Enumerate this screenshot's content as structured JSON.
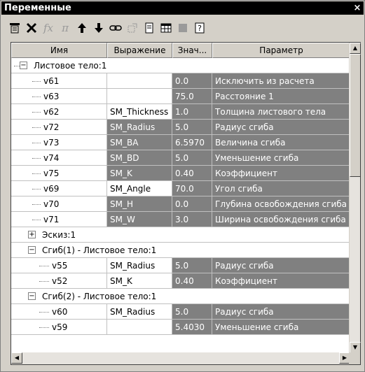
{
  "window": {
    "title": "Переменные",
    "close": "×"
  },
  "toolbar": [
    {
      "name": "variable-table-icon",
      "glyph": "▦",
      "enabled": true
    },
    {
      "name": "delete-icon",
      "glyph": "✕",
      "enabled": true
    },
    {
      "name": "function-icon",
      "glyph": "fx",
      "enabled": false
    },
    {
      "name": "pi-icon",
      "glyph": "π",
      "enabled": false
    },
    {
      "name": "move-up-icon",
      "glyph": "🡅",
      "enabled": true
    },
    {
      "name": "move-down-icon",
      "glyph": "🡇",
      "enabled": true
    },
    {
      "name": "link-icon",
      "glyph": "⚭",
      "enabled": true
    },
    {
      "name": "external-link-icon",
      "glyph": "⬚",
      "enabled": false
    },
    {
      "name": "insert-icon",
      "glyph": "🗎",
      "enabled": true
    },
    {
      "name": "table-icon",
      "glyph": "▤",
      "enabled": true
    },
    {
      "name": "book-icon",
      "glyph": "▮",
      "enabled": false
    },
    {
      "name": "help-icon",
      "glyph": "?",
      "enabled": true
    }
  ],
  "columns": {
    "name": "Имя",
    "expr": "Выражение",
    "val": "Знач...",
    "param": "Параметр"
  },
  "groups": {
    "g1": "Листовое тело:1",
    "g2": "Эскиз:1",
    "g3": "Сгиб(1) -  Листовое тело:1",
    "g4": "Сгиб(2) -  Листовое тело:1"
  },
  "rows": [
    {
      "name": "v61",
      "expr": "",
      "val": "0.0",
      "param": "Исключить из расчета"
    },
    {
      "name": "v63",
      "expr": "",
      "val": "75.0",
      "param": "Расстояние 1"
    },
    {
      "name": "v62",
      "expr": "SM_Thickness",
      "val": "1.0",
      "param": "Толщина листового тела"
    },
    {
      "name": "v72",
      "expr": "SM_Radius",
      "val": "5.0",
      "param": "Радиус сгиба"
    },
    {
      "name": "v73",
      "expr": "SM_BA",
      "val": "6.5970",
      "param": "Величина сгиба"
    },
    {
      "name": "v74",
      "expr": "SM_BD",
      "val": "5.0",
      "param": "Уменьшение сгиба"
    },
    {
      "name": "v75",
      "expr": "SM_K",
      "val": "0.40",
      "param": "Коэффициент"
    },
    {
      "name": "v69",
      "expr": "SM_Angle",
      "val": "70.0",
      "param": "Угол сгиба"
    },
    {
      "name": "v70",
      "expr": "SM_H",
      "val": "0.0",
      "param": "Глубина освобождения сгиба"
    },
    {
      "name": "v71",
      "expr": "SM_W",
      "val": "3.0",
      "param": "Ширина освобождения сгиба"
    },
    {
      "name": "v55",
      "expr": "SM_Radius",
      "val": "5.0",
      "param": "Радиус сгиба"
    },
    {
      "name": "v52",
      "expr": "SM_K",
      "val": "0.40",
      "param": "Коэффициент"
    },
    {
      "name": "v60",
      "expr": "SM_Radius",
      "val": "5.0",
      "param": "Радиус сгиба"
    },
    {
      "name": "v59",
      "expr": "",
      "val": "5.4030",
      "param": "Уменьшение сгиба"
    }
  ],
  "colors": {
    "dark_cell": "#808080",
    "header": "#d4d0c8"
  }
}
